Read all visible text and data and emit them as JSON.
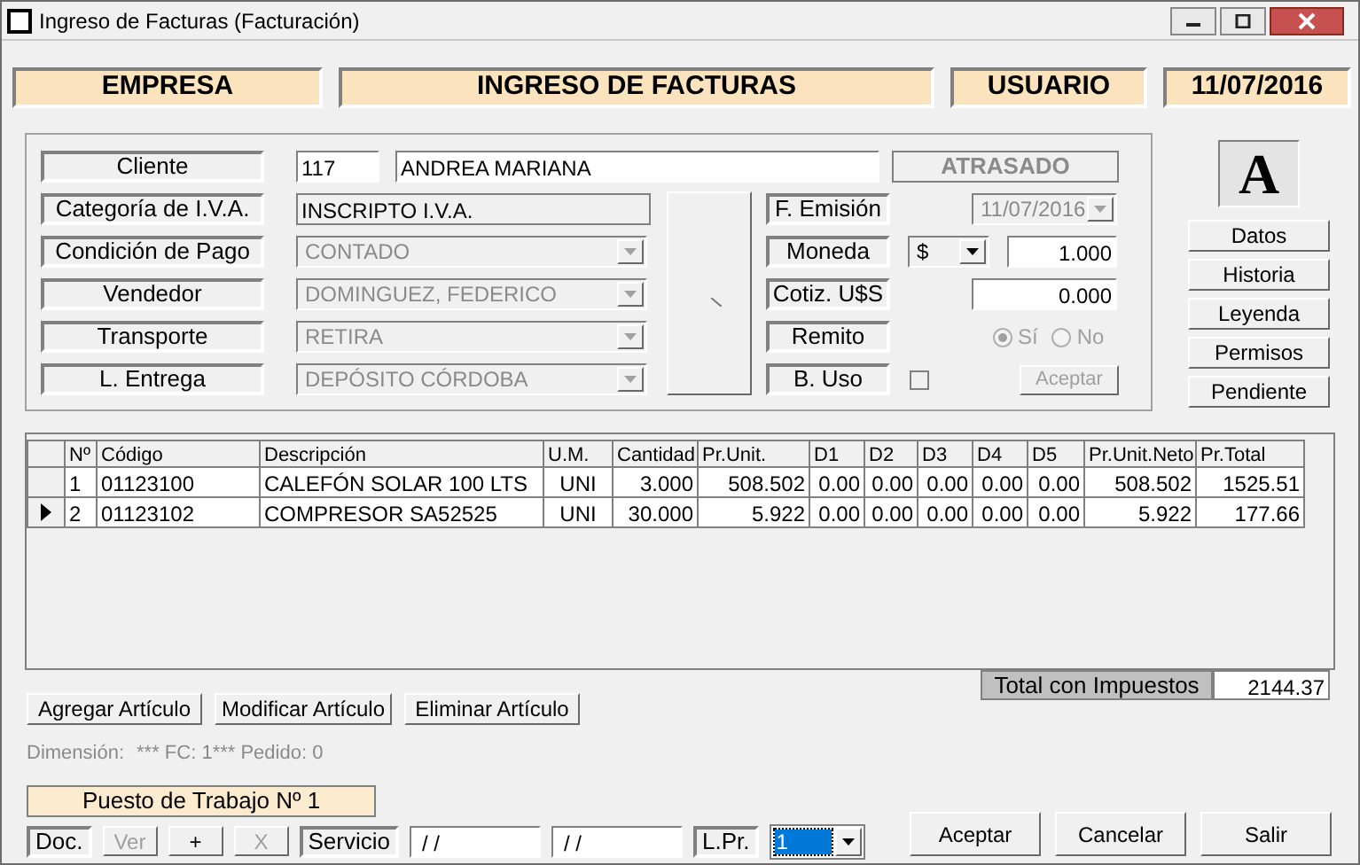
{
  "window": {
    "title": "Ingreso de Facturas (Facturación)"
  },
  "header": [
    "EMPRESA",
    "INGRESO DE FACTURAS",
    "USUARIO",
    "11/07/2016"
  ],
  "cliente": {
    "label": "Cliente",
    "code": "117",
    "name": "ANDREA MARIANA",
    "status": "ATRASADO"
  },
  "left_fields": [
    {
      "label": "Categoría de I.V.A.",
      "kind": "text",
      "value": "INSCRIPTO I.V.A."
    },
    {
      "label": "Condición de Pago",
      "kind": "dropdown",
      "value": "CONTADO",
      "disabled": true
    },
    {
      "label": "Vendedor",
      "kind": "dropdown",
      "value": "DOMINGUEZ, FEDERICO",
      "disabled": true
    },
    {
      "label": "Transporte",
      "kind": "dropdown",
      "value": "RETIRA",
      "disabled": true
    },
    {
      "label": "L. Entrega",
      "kind": "dropdown",
      "value": "DEPÓSITO CÓRDOBA",
      "disabled": true
    }
  ],
  "right_fields": [
    {
      "label": "F. Emisión",
      "kind": "date",
      "value": "11/07/2016",
      "disabled": true
    },
    {
      "label": "Moneda",
      "kind": "currency",
      "currency": "$",
      "value": "1.000"
    },
    {
      "label": "Cotiz. U$S",
      "kind": "number",
      "value": "0.000"
    },
    {
      "label": "Remito",
      "kind": "radios",
      "disabled": true,
      "options": [
        {
          "label": "Sí",
          "selected": true
        },
        {
          "label": "No",
          "selected": false
        }
      ]
    },
    {
      "label": "B. Uso",
      "kind": "checkbox",
      "checked": false,
      "button": {
        "label": "Aceptar",
        "disabled": true
      }
    }
  ],
  "logo_letter": "A",
  "side_buttons": [
    "Datos",
    "Historia",
    "Leyenda",
    "Permisos",
    "Pendiente"
  ],
  "table": {
    "columns": [
      "Nº",
      "Código",
      "Descripción",
      "U.M.",
      "Cantidad",
      "Pr.Unit.",
      "D1",
      "D2",
      "D3",
      "D4",
      "D5",
      "Pr.Unit.Neto",
      "Pr.Total"
    ],
    "rows": [
      {
        "current": false,
        "cells": [
          "1",
          "01123100",
          "CALEFÓN SOLAR 100 LTS",
          "UNI",
          "3.000",
          "508.502",
          "0.00",
          "0.00",
          "0.00",
          "0.00",
          "0.00",
          "508.502",
          "1525.51"
        ]
      },
      {
        "current": true,
        "cells": [
          "2",
          "01123102",
          "COMPRESOR SA52525",
          "UNI",
          "30.000",
          "5.922",
          "0.00",
          "0.00",
          "0.00",
          "0.00",
          "0.00",
          "5.922",
          "177.66"
        ]
      }
    ]
  },
  "total": {
    "label": "Total con Impuestos",
    "value": "2144.37"
  },
  "article_buttons": [
    "Agregar Artículo",
    "Modificar Artículo",
    "Eliminar Artículo"
  ],
  "dimension": {
    "label": "Dimensión:",
    "value": "*** FC: 1*** Pedido: 0"
  },
  "workstation": "Puesto de Trabajo Nº 1",
  "toolbar": [
    {
      "kind": "label",
      "text": "Doc."
    },
    {
      "kind": "button",
      "text": "Ver",
      "disabled": true
    },
    {
      "kind": "button",
      "text": "+",
      "disabled": false
    },
    {
      "kind": "button",
      "text": "X",
      "disabled": true
    },
    {
      "kind": "label",
      "text": "Servicio"
    },
    {
      "kind": "field",
      "text": "/ /"
    },
    {
      "kind": "field",
      "text": "/ /"
    },
    {
      "kind": "label",
      "text": "L.Pr."
    },
    {
      "kind": "dropdown",
      "text": "1"
    }
  ],
  "action_buttons": [
    "Aceptar",
    "Cancelar",
    "Salir"
  ]
}
